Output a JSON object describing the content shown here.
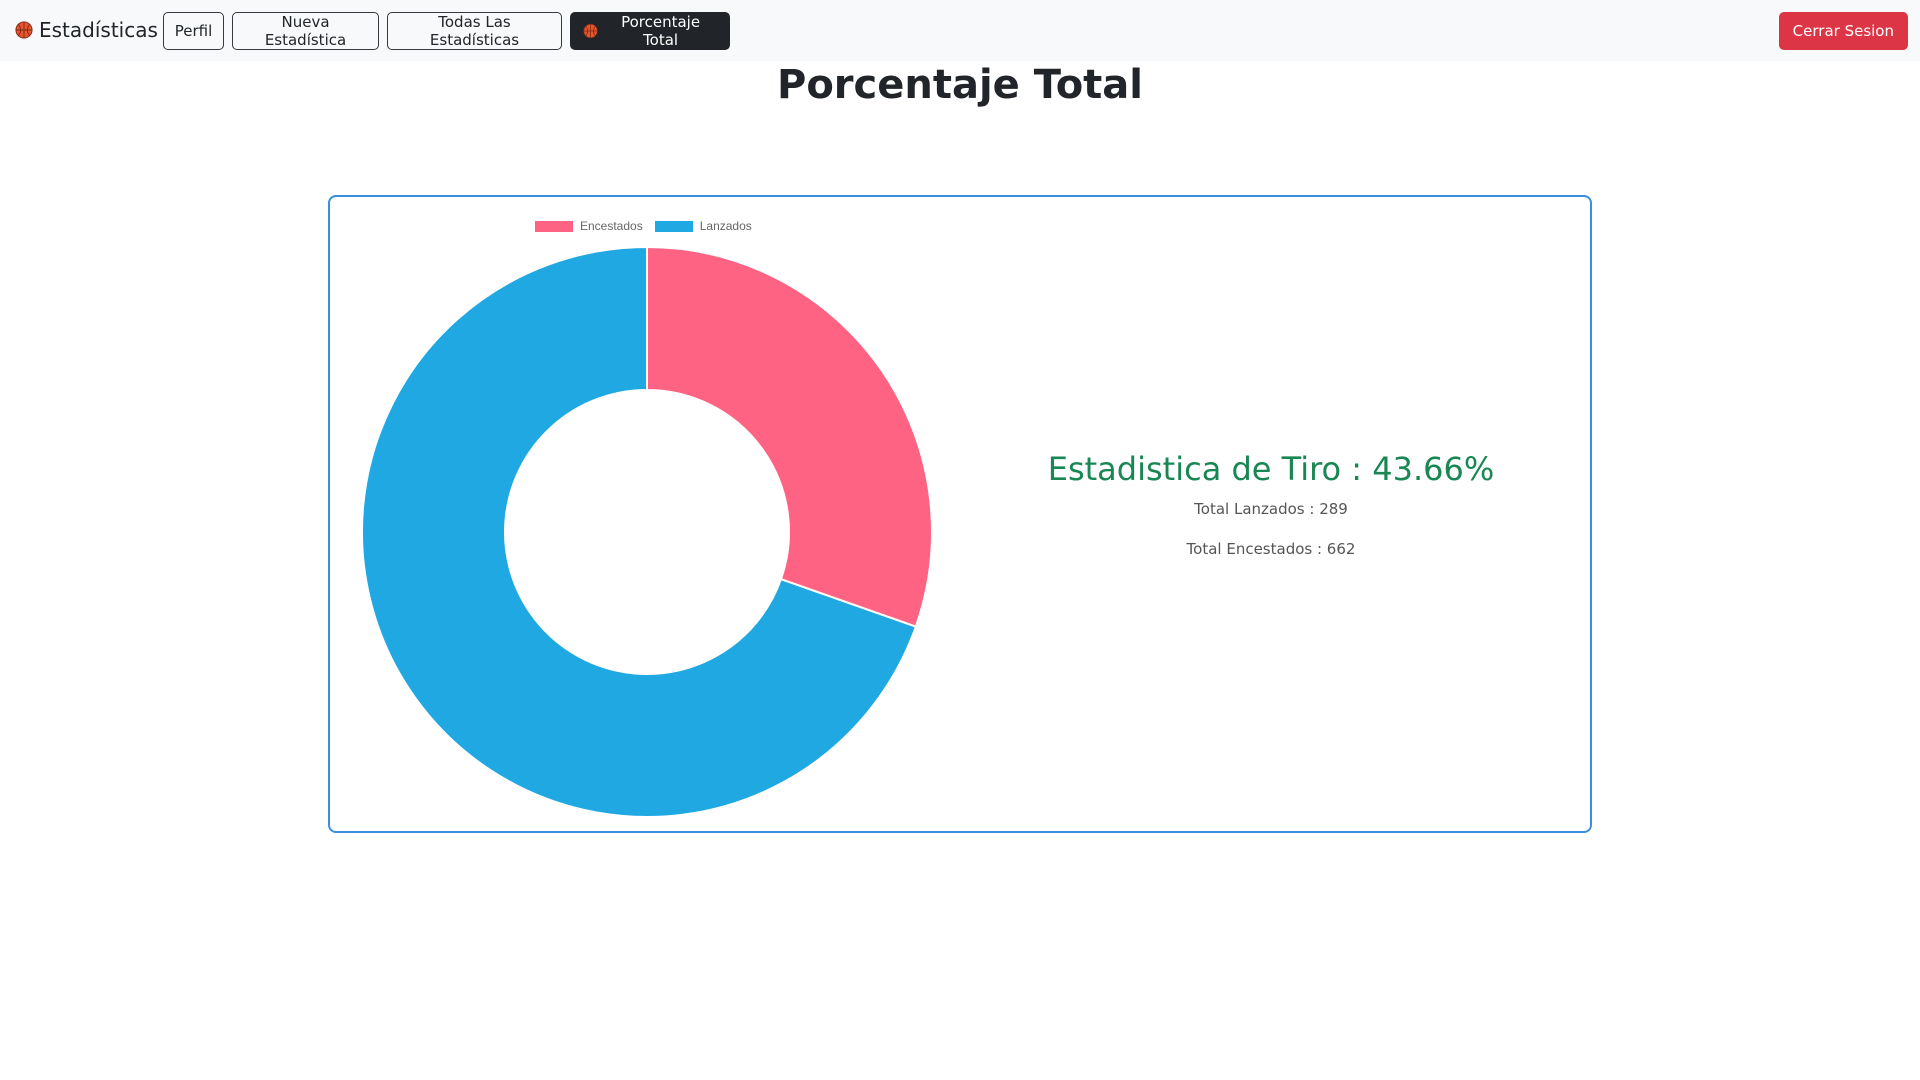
{
  "navbar": {
    "brand_label": "Estadísticas",
    "brand_icon": "basketball-icon",
    "buttons": [
      {
        "label": "Perfil"
      },
      {
        "label": "Nueva Estadística"
      },
      {
        "label": "Todas Las Estadísticas"
      },
      {
        "label": "Porcentaje Total",
        "icon": "basketball-icon",
        "active": true
      }
    ],
    "logout_label": "Cerrar Sesion"
  },
  "page": {
    "title": "Porcentaje Total"
  },
  "stats": {
    "headline": "Estadistica de Tiro : 43.66%",
    "lanzados_line": "Total Lanzados : 289",
    "encestados_line": "Total Encestados : 662"
  },
  "colors": {
    "encestados": "#ff6384",
    "lanzados": "#20a8e3",
    "success": "#198754",
    "danger": "#dc3545",
    "border": "#3a8fe0"
  },
  "chart_data": {
    "type": "pie",
    "variant": "doughnut",
    "labels": [
      "Encestados",
      "Lanzados"
    ],
    "values": [
      289,
      662
    ],
    "legend_position": "top"
  }
}
